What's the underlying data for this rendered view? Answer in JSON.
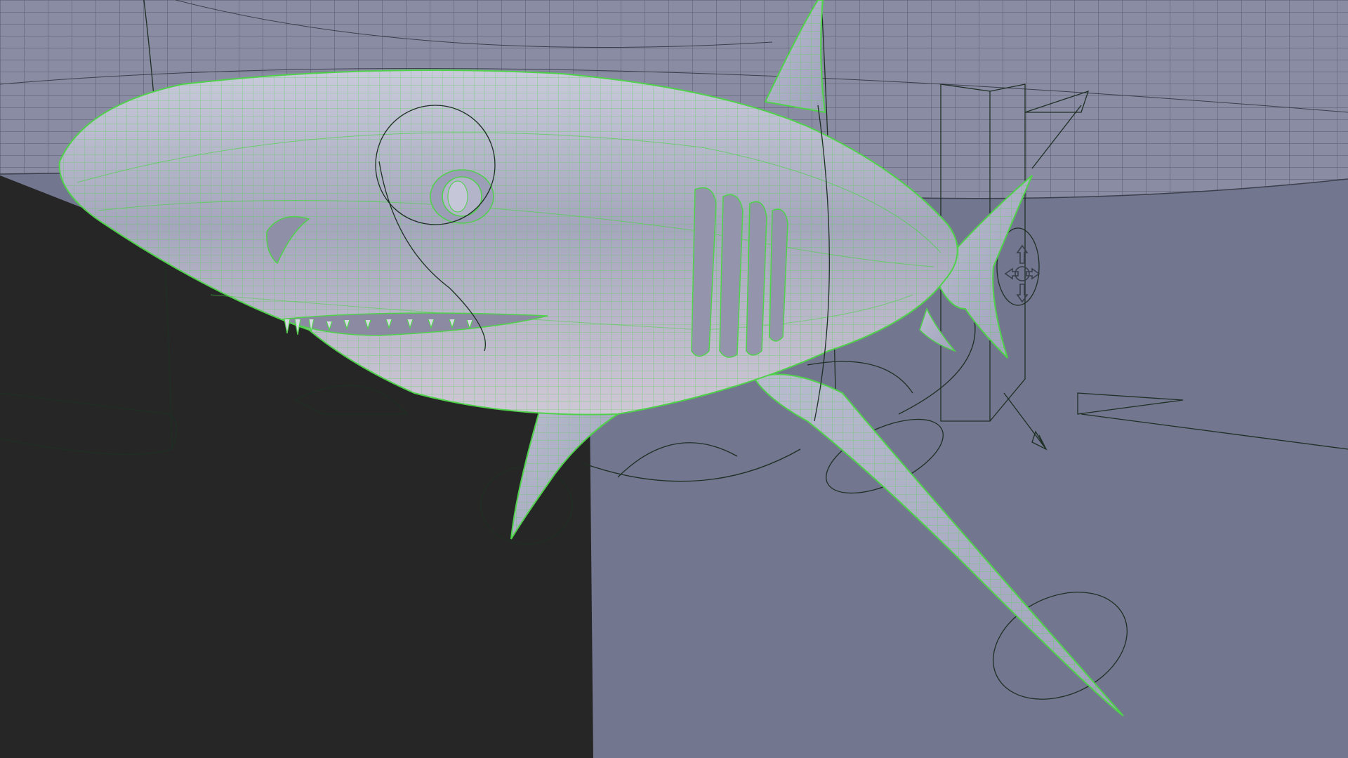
{
  "viewport": {
    "view": "perspective-3d-viewport",
    "mode": "smooth-shaded-with-wireframe-on-shaded",
    "selected_object": "shark-mesh"
  },
  "colors": {
    "background": "#72768f",
    "dark_backdrop": "#262626",
    "ceiling_surface": "#8a8ca4",
    "mesh_body": "#b3b4ca",
    "wireframe_selected": "#4fd24a",
    "rig_controls": "#1e2f24"
  },
  "icons": {
    "translate_manipulator": "move-arrows-icon"
  }
}
